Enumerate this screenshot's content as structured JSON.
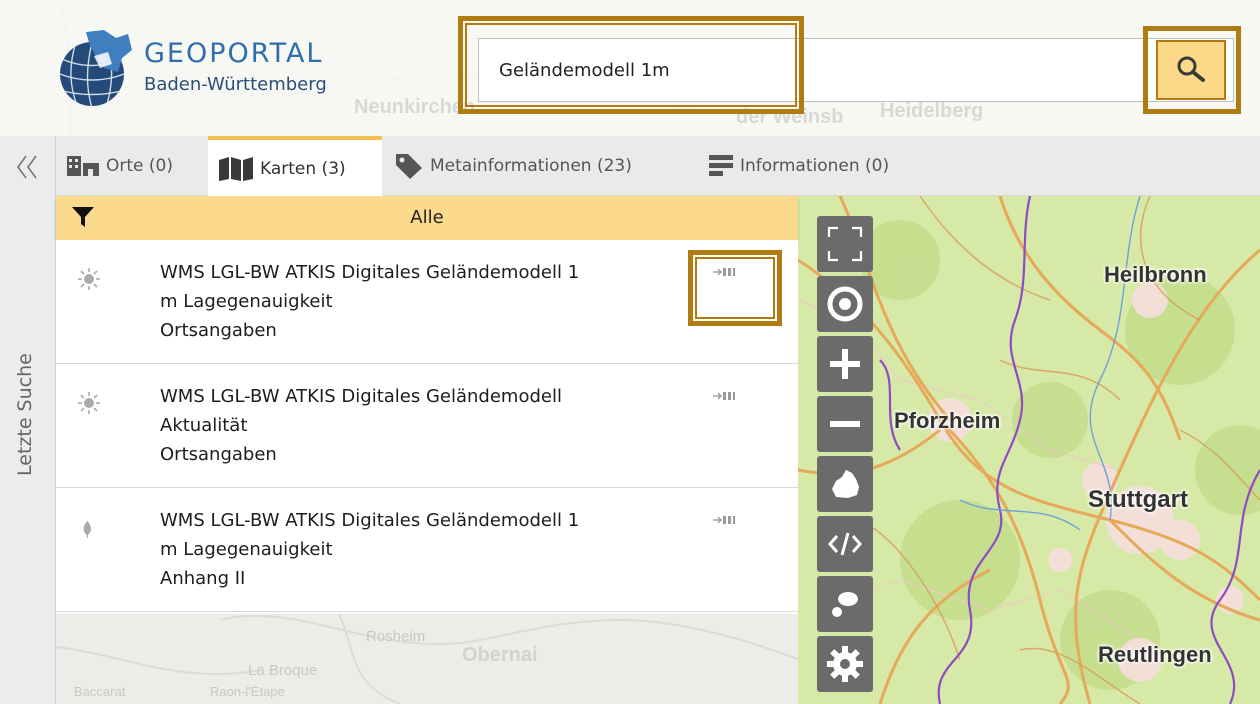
{
  "header": {
    "logo_title": "GEOPORTAL",
    "logo_subtitle": "Baden-Württemberg"
  },
  "search": {
    "value": "Geländemodell 1m",
    "button_icon": "magnifier-icon"
  },
  "side": {
    "collapse_icon": "double-chevron-left-icon",
    "recent_label": "Letzte Suche"
  },
  "tabs": [
    {
      "label": "Orte (0)",
      "icon": "buildings-icon",
      "active": false
    },
    {
      "label": "Karten (3)",
      "icon": "map-icon",
      "active": true
    },
    {
      "label": "Metainformationen (23)",
      "icon": "tag-icon",
      "active": false
    },
    {
      "label": "Informationen (0)",
      "icon": "document-icon",
      "active": false
    }
  ],
  "filter": {
    "icon": "filter-icon",
    "label": "Alle"
  },
  "results": [
    {
      "title_line1": "WMS LGL-BW ATKIS Digitales Geländemodell 1",
      "title_line2": "m Lagegenauigkeit",
      "category": "Ortsangaben",
      "icon": "sun-icon",
      "action_icon": "add-layer-icon"
    },
    {
      "title_line1": "WMS LGL-BW ATKIS Digitales Geländemodell",
      "title_line2": "Aktualität",
      "category": "Ortsangaben",
      "icon": "sun-icon",
      "action_icon": "add-layer-icon"
    },
    {
      "title_line1": "WMS LGL-BW ATKIS Digitales Geländemodell 1",
      "title_line2": "m Lagegenauigkeit",
      "category": "Anhang II",
      "icon": "leaf-icon",
      "action_icon": "add-layer-icon"
    }
  ],
  "map_controls": [
    {
      "name": "fullscreen",
      "icon": "fullscreen-icon"
    },
    {
      "name": "locate",
      "icon": "target-icon"
    },
    {
      "name": "zoom-in",
      "icon": "plus-icon"
    },
    {
      "name": "zoom-out",
      "icon": "minus-icon"
    },
    {
      "name": "home",
      "icon": "state-outline-icon"
    },
    {
      "name": "embed",
      "icon": "code-icon"
    },
    {
      "name": "legend",
      "icon": "bubbles-icon"
    },
    {
      "name": "settings",
      "icon": "gear-icon"
    }
  ],
  "map_labels": {
    "heilbronn": "Heilbronn",
    "pforzheim": "Pforzheim",
    "stuttgart": "Stuttgart",
    "reutlingen": "Reutlingen",
    "rosheim": "Rosheim",
    "obernai": "Obernai",
    "la_broque": "La Broque",
    "baccarat": "Baccarat",
    "raon": "Raon-l'Étape",
    "heidelberg": "Heidelberg",
    "neunkirchen": "Neunkirchen",
    "weinsberg_frag": "der Weinsb"
  },
  "colors": {
    "accent": "#fbd98d",
    "highlight_frame": "#b07c12",
    "logo_blue": "#2f6eaa",
    "control_grey": "#6b6b6b"
  }
}
